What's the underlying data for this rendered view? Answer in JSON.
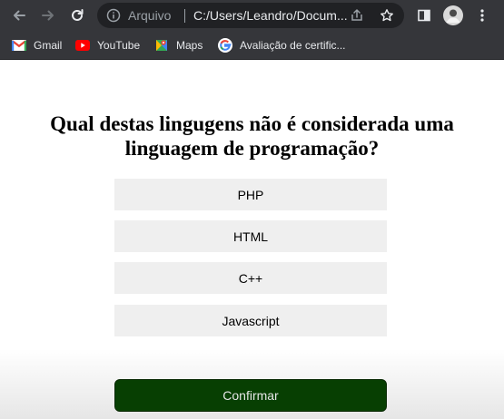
{
  "browser": {
    "omnibox": {
      "scheme_label": "Arquivo",
      "url": "C:/Users/Leandro/Docum..."
    },
    "bookmarks": [
      {
        "label": "Gmail",
        "icon": "gmail-icon"
      },
      {
        "label": "YouTube",
        "icon": "youtube-icon"
      },
      {
        "label": "Maps",
        "icon": "maps-icon"
      },
      {
        "label": "Avaliação de certific...",
        "icon": "google-icon"
      }
    ]
  },
  "quiz": {
    "question": "Qual destas lingugens não é considerada uma linguagem de programação?",
    "options": [
      {
        "label": "PHP"
      },
      {
        "label": "HTML"
      },
      {
        "label": "C++"
      },
      {
        "label": "Javascript"
      }
    ],
    "confirm_label": "Confirmar"
  },
  "colors": {
    "chrome_bg": "#35363a",
    "omnibox_bg": "#202124",
    "option_bg": "#efefef",
    "confirm_bg": "#073f02"
  }
}
